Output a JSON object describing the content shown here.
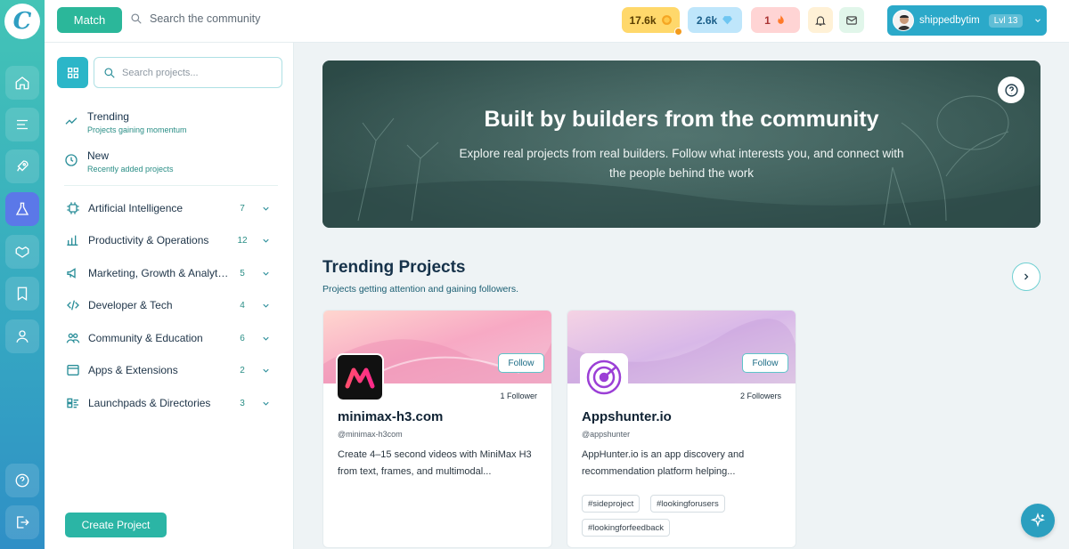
{
  "rail": {
    "logo_letter": "C",
    "items": [
      {
        "name": "home-icon"
      },
      {
        "name": "feed-icon"
      },
      {
        "name": "rocket-icon"
      },
      {
        "name": "flask-icon"
      },
      {
        "name": "handshake-icon"
      },
      {
        "name": "bookmark-icon"
      },
      {
        "name": "user-icon"
      }
    ],
    "bottom": [
      {
        "name": "help-icon"
      },
      {
        "name": "logout-icon"
      }
    ]
  },
  "topbar": {
    "match_label": "Match",
    "search_placeholder": "Search the community",
    "coins": "17.6k",
    "gems": "2.6k",
    "streak": "1",
    "username": "shippedbytim",
    "level": "Lvl 13"
  },
  "sidebar": {
    "search_placeholder": "Search projects...",
    "quick": [
      {
        "title": "Trending",
        "subtitle": "Projects gaining momentum"
      },
      {
        "title": "New",
        "subtitle": "Recently added projects"
      }
    ],
    "categories": [
      {
        "label": "Artificial Intelligence",
        "count": "7"
      },
      {
        "label": "Productivity & Operations",
        "count": "12"
      },
      {
        "label": "Marketing, Growth & Analytics",
        "count": "5"
      },
      {
        "label": "Developer & Tech",
        "count": "4"
      },
      {
        "label": "Community & Education",
        "count": "6"
      },
      {
        "label": "Apps & Extensions",
        "count": "2"
      },
      {
        "label": "Launchpads & Directories",
        "count": "3"
      }
    ],
    "create_label": "Create Project"
  },
  "hero": {
    "title": "Built by builders from the community",
    "subtitle": "Explore real projects from real builders. Follow what interests you, and connect with the people behind the work"
  },
  "trending": {
    "title": "Trending Projects",
    "subtitle": "Projects getting attention and gaining followers."
  },
  "cards": [
    {
      "name": "minimax-h3.com",
      "handle": "@minimax-h3com",
      "followers": "1 Follower",
      "follow_label": "Follow",
      "description": "Create 4–15 second videos with MiniMax H3 from text, frames, and multimodal...",
      "tags": []
    },
    {
      "name": "Appshunter.io",
      "handle": "@appshunter",
      "followers": "2 Followers",
      "follow_label": "Follow",
      "description": "AppHunter.io is an app discovery and recommendation platform helping...",
      "tags": [
        "#sideproject",
        "#lookingforusers",
        "#lookingforfeedback"
      ]
    }
  ],
  "colors": {
    "accent": "#2bb79a",
    "rail_active": "#5b78e8",
    "brand": "#2ba9c9"
  }
}
